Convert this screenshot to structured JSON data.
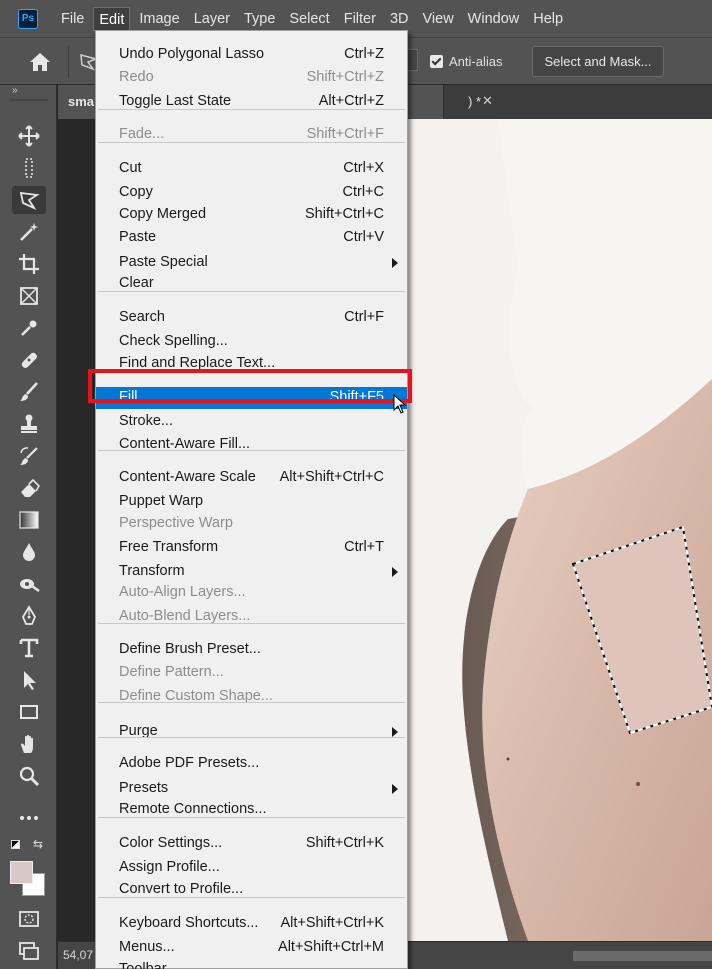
{
  "app": {
    "logo": "Ps"
  },
  "menubar": {
    "items": [
      "File",
      "Edit",
      "Image",
      "Layer",
      "Type",
      "Select",
      "Filter",
      "3D",
      "View",
      "Window",
      "Help"
    ],
    "active": "Edit"
  },
  "options_bar": {
    "anti_alias_label": "Anti-alias",
    "anti_alias_checked": true,
    "select_and_mask_label": "Select and Mask..."
  },
  "document": {
    "tab_name": "sma",
    "tab_suffix": ") *",
    "close_glyph": "✕",
    "zoom_status": "54,07"
  },
  "edit_menu": {
    "groups": [
      [
        {
          "label": "Undo Polygonal Lasso",
          "shortcut": "Ctrl+Z",
          "enabled": true
        },
        {
          "label": "Redo",
          "shortcut": "Shift+Ctrl+Z",
          "enabled": false
        },
        {
          "label": "Toggle Last State",
          "shortcut": "Alt+Ctrl+Z",
          "enabled": true
        }
      ],
      [
        {
          "label": "Fade...",
          "shortcut": "Shift+Ctrl+F",
          "enabled": false
        }
      ],
      [
        {
          "label": "Cut",
          "shortcut": "Ctrl+X",
          "enabled": true
        },
        {
          "label": "Copy",
          "shortcut": "Ctrl+C",
          "enabled": true
        },
        {
          "label": "Copy Merged",
          "shortcut": "Shift+Ctrl+C",
          "enabled": true
        },
        {
          "label": "Paste",
          "shortcut": "Ctrl+V",
          "enabled": true
        },
        {
          "label": "Paste Special",
          "shortcut": "",
          "enabled": true,
          "submenu": true
        },
        {
          "label": "Clear",
          "shortcut": "",
          "enabled": true
        }
      ],
      [
        {
          "label": "Search",
          "shortcut": "Ctrl+F",
          "enabled": true
        },
        {
          "label": "Check Spelling...",
          "shortcut": "",
          "enabled": true
        },
        {
          "label": "Find and Replace Text...",
          "shortcut": "",
          "enabled": true
        }
      ],
      [
        {
          "label": "Fill...",
          "shortcut": "Shift+F5",
          "enabled": true,
          "highlighted": true
        },
        {
          "label": "Stroke...",
          "shortcut": "",
          "enabled": true
        },
        {
          "label": "Content-Aware Fill...",
          "shortcut": "",
          "enabled": true
        }
      ],
      [
        {
          "label": "Content-Aware Scale",
          "shortcut": "Alt+Shift+Ctrl+C",
          "enabled": true
        },
        {
          "label": "Puppet Warp",
          "shortcut": "",
          "enabled": true
        },
        {
          "label": "Perspective Warp",
          "shortcut": "",
          "enabled": false
        },
        {
          "label": "Free Transform",
          "shortcut": "Ctrl+T",
          "enabled": true
        },
        {
          "label": "Transform",
          "shortcut": "",
          "enabled": true,
          "submenu": true
        },
        {
          "label": "Auto-Align Layers...",
          "shortcut": "",
          "enabled": false
        },
        {
          "label": "Auto-Blend Layers...",
          "shortcut": "",
          "enabled": false
        }
      ],
      [
        {
          "label": "Define Brush Preset...",
          "shortcut": "",
          "enabled": true
        },
        {
          "label": "Define Pattern...",
          "shortcut": "",
          "enabled": false
        },
        {
          "label": "Define Custom Shape...",
          "shortcut": "",
          "enabled": false
        }
      ],
      [
        {
          "label": "Purge",
          "shortcut": "",
          "enabled": true,
          "submenu": true
        }
      ],
      [
        {
          "label": "Adobe PDF Presets...",
          "shortcut": "",
          "enabled": true
        },
        {
          "label": "Presets",
          "shortcut": "",
          "enabled": true,
          "submenu": true
        },
        {
          "label": "Remote Connections...",
          "shortcut": "",
          "enabled": true
        }
      ],
      [
        {
          "label": "Color Settings...",
          "shortcut": "Shift+Ctrl+K",
          "enabled": true
        },
        {
          "label": "Assign Profile...",
          "shortcut": "",
          "enabled": true
        },
        {
          "label": "Convert to Profile...",
          "shortcut": "",
          "enabled": true
        }
      ],
      [
        {
          "label": "Keyboard Shortcuts...",
          "shortcut": "Alt+Shift+Ctrl+K",
          "enabled": true
        },
        {
          "label": "Menus...",
          "shortcut": "Alt+Shift+Ctrl+M",
          "enabled": true
        },
        {
          "label": "Toolbar...",
          "shortcut": "",
          "enabled": true
        }
      ]
    ]
  },
  "toolbar": {
    "tools": [
      "move-tool-icon",
      "marquee-tool-icon",
      "polygonal-lasso-tool-icon",
      "magic-wand-tool-icon",
      "crop-tool-icon",
      "frame-tool-icon",
      "eyedropper-tool-icon",
      "healing-brush-tool-icon",
      "brush-tool-icon",
      "clone-stamp-tool-icon",
      "history-brush-tool-icon",
      "eraser-tool-icon",
      "gradient-tool-icon",
      "blur-tool-icon",
      "dodge-tool-icon",
      "pen-tool-icon",
      "type-tool-icon",
      "path-selection-tool-icon",
      "rectangle-tool-icon",
      "hand-tool-icon",
      "zoom-tool-icon",
      "more-tools-icon"
    ],
    "selected_tool": "polygonal-lasso-tool-icon",
    "foreground_color": "#d9c8c3",
    "background_color": "#ffffff"
  },
  "colors": {
    "highlight": "#0078d7",
    "annotation_box": "#e8121a",
    "ui_panel": "#535353"
  }
}
